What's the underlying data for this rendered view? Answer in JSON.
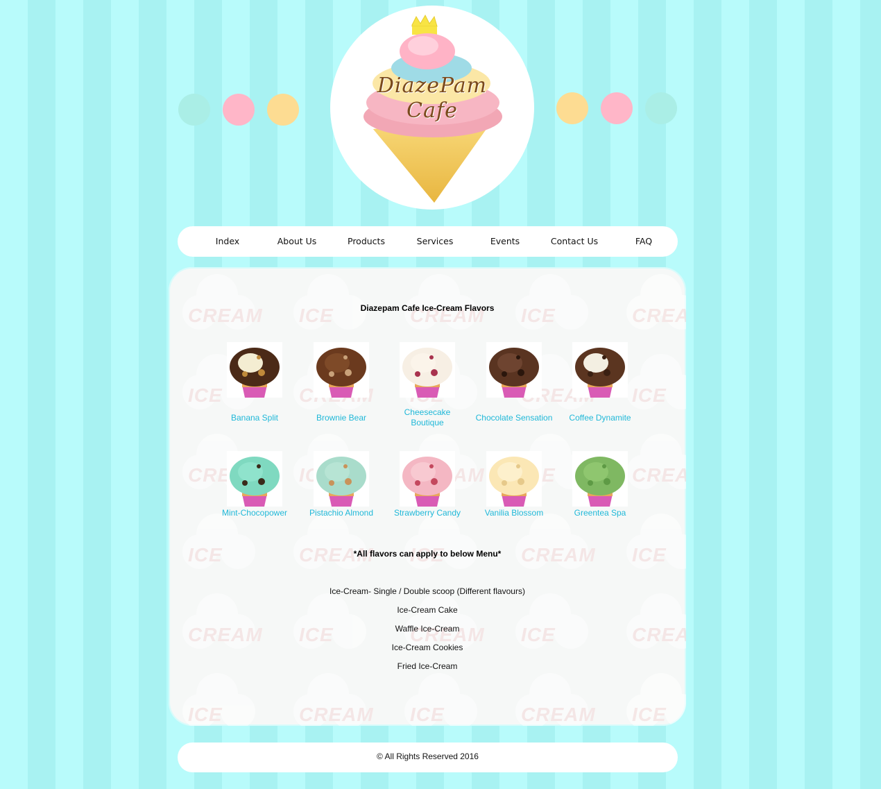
{
  "brand": {
    "logo_line1": "DiazePam",
    "logo_line2": "Cafe",
    "dots_left": [
      "#aaeee6",
      "#ffb6c8",
      "#fddc92"
    ],
    "dots_right": [
      "#fddc92",
      "#ffb6c8",
      "#aaeee6"
    ]
  },
  "nav": {
    "items": [
      {
        "label": "Index"
      },
      {
        "label": "About Us"
      },
      {
        "label": "Products"
      },
      {
        "label": "Services"
      },
      {
        "label": "Events"
      },
      {
        "label": "Contact Us"
      },
      {
        "label": "FAQ"
      }
    ]
  },
  "content": {
    "title": "Diazepam Cafe Ice-Cream Flavors",
    "flavors": [
      {
        "name": "Banana Split",
        "colors": [
          "#4b2a17",
          "#f4edd2",
          "#c08a3a"
        ]
      },
      {
        "name": "Brownie Bear",
        "colors": [
          "#6b3a1e",
          "#7e4a28",
          "#c9a27a"
        ]
      },
      {
        "name": "Cheesecake Boutique",
        "colors": [
          "#f7efe4",
          "#fbf4ea",
          "#a8324e"
        ]
      },
      {
        "name": "Chocolate Sensation",
        "colors": [
          "#5a3421",
          "#6e4430",
          "#2a160c"
        ]
      },
      {
        "name": "Coffee Dynamite",
        "colors": [
          "#5b3520",
          "#f3efe2",
          "#3a2012"
        ]
      },
      {
        "name": "Mint-Chocopower",
        "colors": [
          "#7fd9c0",
          "#8fe3cc",
          "#3a2a1a"
        ]
      },
      {
        "name": "Pistachio Almond",
        "colors": [
          "#a9dccb",
          "#b7e4d4",
          "#c9935a"
        ]
      },
      {
        "name": "Strawberry Candy",
        "colors": [
          "#f4b7c3",
          "#f8c9d1",
          "#c4485e"
        ]
      },
      {
        "name": "Vanilia Blossom",
        "colors": [
          "#fbe7b5",
          "#fdf0cc",
          "#e6c98a"
        ]
      },
      {
        "name": "Greentea Spa",
        "colors": [
          "#7fb862",
          "#8fc66f",
          "#5e9a45"
        ]
      }
    ],
    "note": "*All flavors can apply to below Menu*",
    "menu": [
      "Ice-Cream- Single / Double scoop (Different flavours)",
      "Ice-Cream Cake",
      "Waffle Ice-Cream",
      "Ice-Cream Cookies",
      "Fried Ice-Cream"
    ],
    "watermark_text_1": "ICE",
    "watermark_text_2": "CREAM"
  },
  "footer": {
    "copyright": "© All Rights Reserved 2016"
  }
}
